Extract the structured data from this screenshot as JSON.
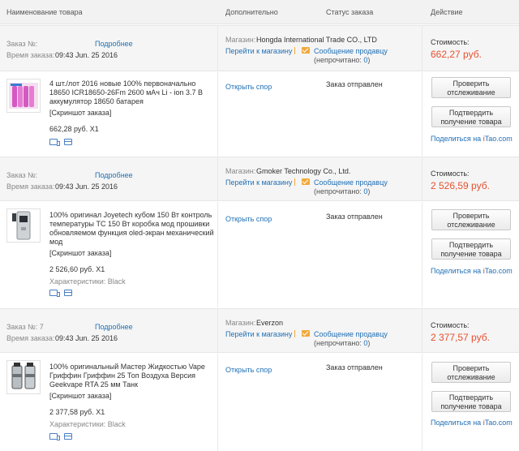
{
  "header": {
    "col_product": "Наименование товара",
    "col_extra": "Дополнительно",
    "col_status": "Статус заказа",
    "col_action": "Действие"
  },
  "orders": [
    {
      "order_no_label": "Заказ №:",
      "details_link": "Подробнее",
      "time_label": "Время заказа:",
      "time_value": "09:43 Jun. 25 2016",
      "shop_label": "Магазин:",
      "shop_name": "Hongda International Trade CO., LTD",
      "go_to_shop": "Перейти к магазину",
      "message_seller": "Сообщение продавцу",
      "unread_label": "(непрочитано: ",
      "unread_count": "0",
      "unread_close": ")",
      "cost_label": "Стоимость:",
      "cost_value": "662,27 руб.",
      "product_title": "4 шт./лот 2016 новые 100% первоначально 18650 ICR18650-26Fm 2600 мАч Li - ion 3.7 В аккумулятор 18650 батарея",
      "snapshot": "[Скриншот заказа]",
      "item_price": "662,28 руб. X1",
      "characteristics": "",
      "dispute": "Открыть спор",
      "status": "Заказ отправлен",
      "btn_track": "Проверить отслеживание",
      "btn_confirm": "Подтвердить получение товара",
      "share_prefix": "Поделиться на ",
      "share_site_i": "i",
      "share_site_rest": "Tao.com"
    },
    {
      "order_no_label": "Заказ №:",
      "details_link": "Подробнее",
      "time_label": "Время заказа:",
      "time_value": "09:43 Jun. 25 2016",
      "shop_label": "Магазин:",
      "shop_name": "Gmoker Technology Co., Ltd.",
      "go_to_shop": "Перейти к магазину",
      "message_seller": "Сообщение продавцу",
      "unread_label": "(непрочитано: ",
      "unread_count": "0",
      "unread_close": ")",
      "cost_label": "Стоимость:",
      "cost_value": "2 526,59 руб.",
      "product_title": "100% оригинал Joyetech кубом 150 Вт контроль температуры TC 150 Вт коробка мод прошивки обновляемом функция oled-экран механический мод",
      "snapshot": "[Скриншот заказа]",
      "item_price": "2 526,60 руб. X1",
      "characteristics": "Характеристики: Black",
      "dispute": "Открыть спор",
      "status": "Заказ отправлен",
      "btn_track": "Проверить отслеживание",
      "btn_confirm": "Подтвердить получение товара",
      "share_prefix": "Поделиться на ",
      "share_site_i": "i",
      "share_site_rest": "Tao.com"
    },
    {
      "order_no_label": "Заказ №: 7",
      "details_link": "Подробнее",
      "time_label": "Время заказа:",
      "time_value": "09:43 Jun. 25 2016",
      "shop_label": "Магазин:",
      "shop_name": "Everzon",
      "go_to_shop": "Перейти к магазину",
      "message_seller": "Сообщение продавцу",
      "unread_label": "(непрочитано: ",
      "unread_count": "0",
      "unread_close": ")",
      "cost_label": "Стоимость:",
      "cost_value": "2 377,57 руб.",
      "product_title": "100% оригинальный Мастер Жидкостью Vape Гриффин Гриффин 25 Топ Воздуха Версия Geekvape RTA 25 мм Танк",
      "snapshot": "[Скриншот заказа]",
      "item_price": "2 377,58 руб. X1",
      "characteristics": "Характеристики: Black",
      "dispute": "Открыть спор",
      "status": "Заказ отправлен",
      "btn_track": "Проверить отслеживание",
      "btn_confirm": "Подтвердить получение товара",
      "share_prefix": "Поделиться на ",
      "share_site_i": "i",
      "share_site_rest": "Tao.com"
    }
  ]
}
